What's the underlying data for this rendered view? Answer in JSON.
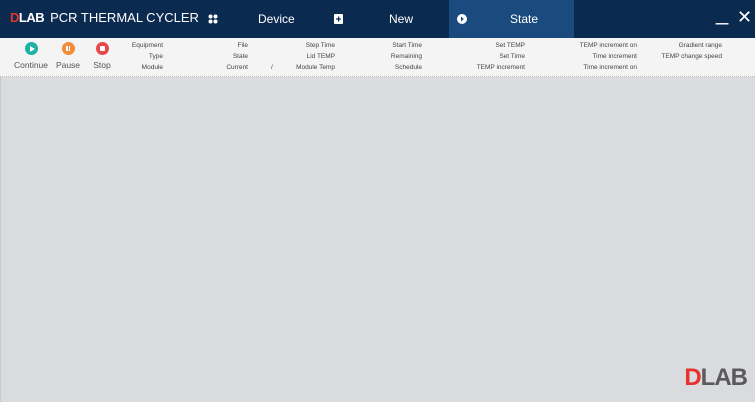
{
  "titlebar": {
    "logo_d": "D",
    "logo_rest": "LAB",
    "title": "PCR THERMAL CYCLER",
    "tabs": [
      {
        "label": "Device",
        "icon": "grid-icon"
      },
      {
        "label": "New",
        "icon": "new-file-icon"
      },
      {
        "label": "State",
        "icon": "arrow-circle-icon"
      }
    ],
    "minimize": "_",
    "close": "✕"
  },
  "toolbar": {
    "continue_label": "Continue",
    "pause_label": "Pause",
    "stop_label": "Stop",
    "fields": {
      "equipment": "Equipment",
      "type": "Type",
      "module": "Module",
      "file": "File",
      "state": "State",
      "current": "Current",
      "current_value": "/",
      "step_time": "Step Time",
      "lid_temp": "Lid TEMP",
      "module_temp": "Module Temp",
      "start_time": "Start Time",
      "remaining": "Remaining",
      "schedule": "Schedule",
      "set_temp": "Set TEMP",
      "set_time": "Set Time",
      "temp_increment": "TEMP increment",
      "temp_increment_on": "TEMP increment on",
      "time_increment": "Time increment",
      "time_increment_on": "Time increment on",
      "gradient_range": "Gradient range",
      "temp_change_speed": "TEMP change speed"
    }
  },
  "watermark": {
    "logo_d": "D",
    "logo_rest": "LAB"
  }
}
